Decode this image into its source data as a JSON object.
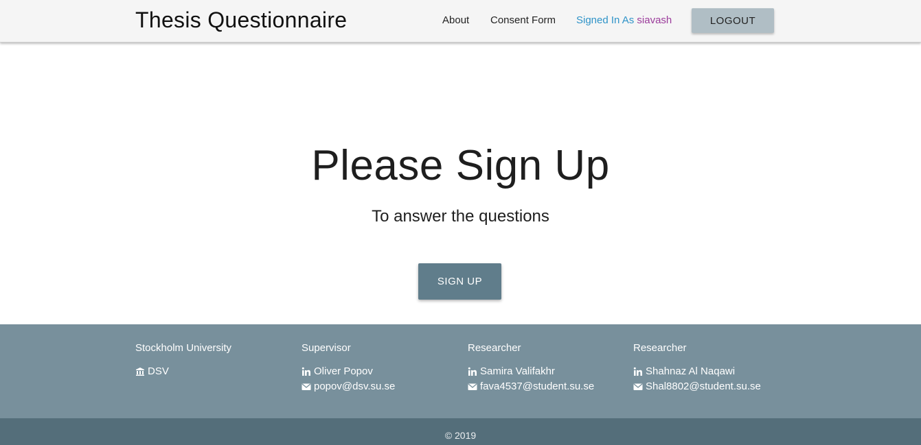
{
  "nav": {
    "brand": "Thesis Questionnaire",
    "about": "About",
    "consent": "Consent Form",
    "signed_prefix": "Signed In As",
    "username": "siavash",
    "logout": "LOGOUT"
  },
  "hero": {
    "title": "Please Sign Up",
    "subtitle": "To answer the questions",
    "signup": "SIGN UP"
  },
  "footer": {
    "columns": [
      {
        "heading": "Stockholm University",
        "line1": "DSV",
        "line1_icon": "institution-icon"
      },
      {
        "heading": "Supervisor",
        "line1": "Oliver Popov",
        "line1_icon": "linkedin-icon",
        "line2": "popov@dsv.su.se",
        "line2_icon": "envelope-icon"
      },
      {
        "heading": "Researcher",
        "line1": "Samira Valifakhr",
        "line1_icon": "linkedin-icon",
        "line2": "fava4537@student.su.se",
        "line2_icon": "envelope-icon"
      },
      {
        "heading": "Researcher",
        "line1": "Shahnaz Al Naqawi",
        "line1_icon": "linkedin-icon",
        "line2": "Shal8802@student.su.se",
        "line2_icon": "envelope-icon"
      }
    ],
    "copyright": "© 2019"
  },
  "colors": {
    "navbar_bg": "#f5f5f5",
    "logout_bg": "#b0bec5",
    "signup_bg": "#607d8b",
    "footer_bg": "#78909c",
    "copyright_bg": "#546e7a",
    "signed_link": "#2e93c8",
    "username": "#9b3b9b"
  }
}
